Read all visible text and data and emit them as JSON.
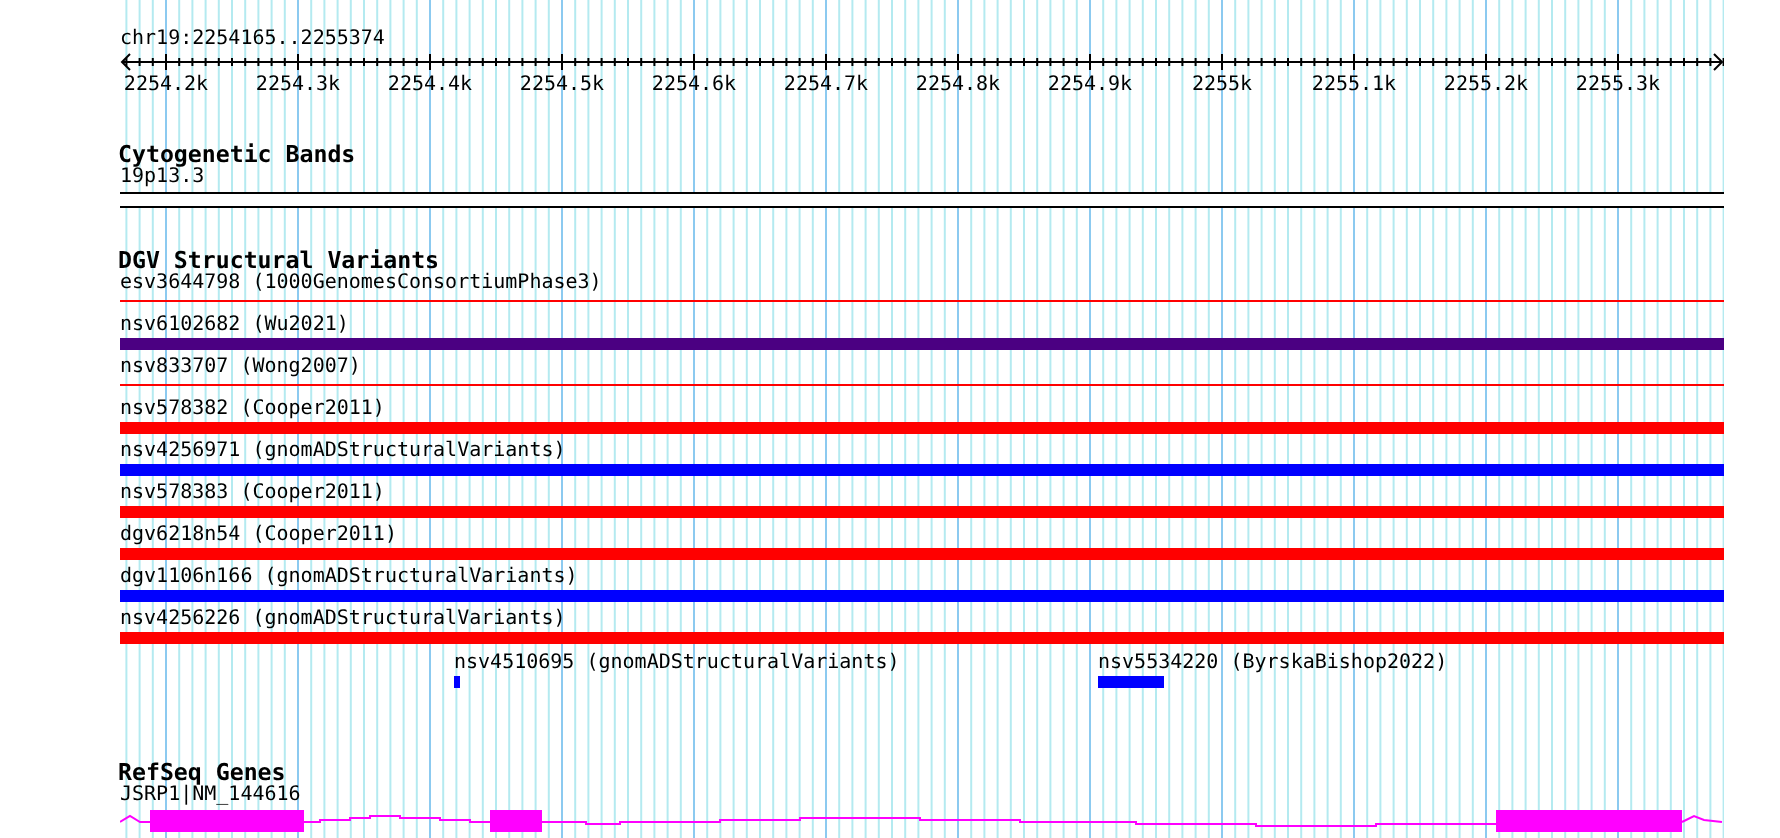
{
  "ruler": {
    "location": "chr19:2254165..2255374",
    "ticks": [
      "2254.2k",
      "2254.3k",
      "2254.4k",
      "2254.5k",
      "2254.6k",
      "2254.7k",
      "2254.8k",
      "2254.9k",
      "2255k",
      "2255.1k",
      "2255.2k",
      "2255.3k"
    ]
  },
  "tracks": [
    {
      "title": "Cytogenetic Bands",
      "kind": "bands",
      "features": [
        {
          "label": "19p13.3"
        }
      ]
    },
    {
      "title": "DGV Structural Variants",
      "kind": "variants",
      "features": [
        {
          "label": "esv3644798 (1000GenomesConsortiumPhase3)",
          "kind": "thin",
          "color": "#ff0000"
        },
        {
          "label": "nsv6102682 (Wu2021)",
          "kind": "bar",
          "color": "#4b0082"
        },
        {
          "label": "nsv833707 (Wong2007)",
          "kind": "thin",
          "color": "#ff0000"
        },
        {
          "label": "nsv578382 (Cooper2011)",
          "kind": "bar",
          "color": "#ff0000"
        },
        {
          "label": "nsv4256971 (gnomADStructuralVariants)",
          "kind": "bar",
          "color": "#0000ff"
        },
        {
          "label": "nsv578383 (Cooper2011)",
          "kind": "bar",
          "color": "#ff0000"
        },
        {
          "label": "dgv6218n54 (Cooper2011)",
          "kind": "bar",
          "color": "#ff0000"
        },
        {
          "label": "dgv1106n166 (gnomADStructuralVariants)",
          "kind": "bar",
          "color": "#0000ff"
        },
        {
          "label": "nsv4256226 (gnomADStructuralVariants)",
          "kind": "bar",
          "color": "#ff0000"
        },
        {
          "label": "nsv4510695 (gnomADStructuralVariants)",
          "kind": "partial",
          "color": "#0000ff"
        },
        {
          "label": "nsv5534220 (ByrskaBishop2022)",
          "kind": "partial",
          "color": "#0000ff"
        }
      ]
    },
    {
      "title": "RefSeq Genes",
      "kind": "genes",
      "features": [
        {
          "label": "JSRP1|NM_144616"
        }
      ]
    }
  ]
}
